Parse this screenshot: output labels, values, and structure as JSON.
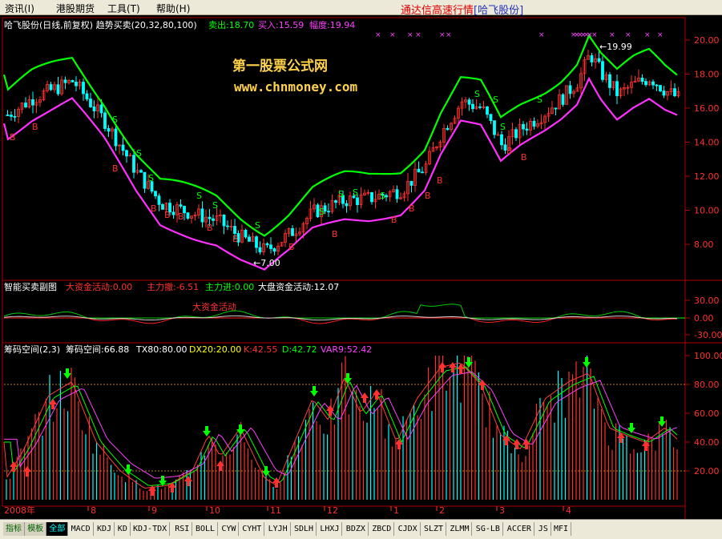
{
  "menu": [
    {
      "label": "资讯(I)",
      "x": 6
    },
    {
      "label": "港股期货",
      "x": 70
    },
    {
      "label": "工具(T)",
      "x": 134
    },
    {
      "label": "帮助(H)",
      "x": 195
    }
  ],
  "app": {
    "title": "通达信高速行情",
    "stock": "[哈飞股份]"
  },
  "main_panel": {
    "header_name": "哈飞股份(日线,前复权) 趋势买卖(20,32,80,100)",
    "sell_label": "卖出:18.70",
    "buy_label": "买入:15.59",
    "range_label": "幅度:19.94",
    "watermark_line1": "第一股票公式网",
    "watermark_line2": "www.chnmoney.com",
    "high_marker": "19.99",
    "low_marker": "7.00",
    "y_ticks": [
      "20.00",
      "18.00",
      "16.00",
      "14.00",
      "12.00",
      "10.00",
      "8.00"
    ],
    "marker_buy": "B",
    "marker_sell": "S"
  },
  "sub_panel1": {
    "title": "智能买卖副图",
    "big_fund": "大资金活动:0.00",
    "main_withdraw": "主力撤:-6.51",
    "main_enter": "主力进:0.00",
    "market_fund": "大盘资金活动:12.07",
    "annotation": "大资金活动",
    "y_ticks": [
      "30.00",
      "0.00",
      "-30.00"
    ]
  },
  "sub_panel2": {
    "title": "筹码空间(2,3)",
    "space": "筹码空间:66.88",
    "tx": "TX80:80.00",
    "dx": "DX20:20.00",
    "k": "K:42.55",
    "d": "D:42.72",
    "var9": "VAR9:52.42",
    "y_ticks": [
      "100.00",
      "80.00",
      "60.00",
      "40.00",
      "20.00"
    ]
  },
  "date_axis": {
    "year_label": "2008年",
    "months": [
      "8",
      "9",
      "10",
      "11",
      "12",
      "1",
      "2",
      "3",
      "4"
    ]
  },
  "tabs": [
    "指标",
    "模板",
    "全部",
    "MACD",
    "KDJ",
    "KD",
    "KDJ-TDX",
    "RSI",
    "BOLL",
    "CYW",
    "CYHT",
    "LYJH",
    "SDLH",
    "LHXJ",
    "BDZX",
    "ZBCD",
    "CJDX",
    "SLZT",
    "ZLMM",
    "SG-LB",
    "ACCER",
    "JS",
    "MFI"
  ],
  "colors": {
    "green": "#00ff00",
    "magenta": "#ff40ff",
    "red": "#ff3333",
    "cyan": "#00ffff",
    "axis": "#b00000",
    "yellow": "#ffff00"
  }
}
